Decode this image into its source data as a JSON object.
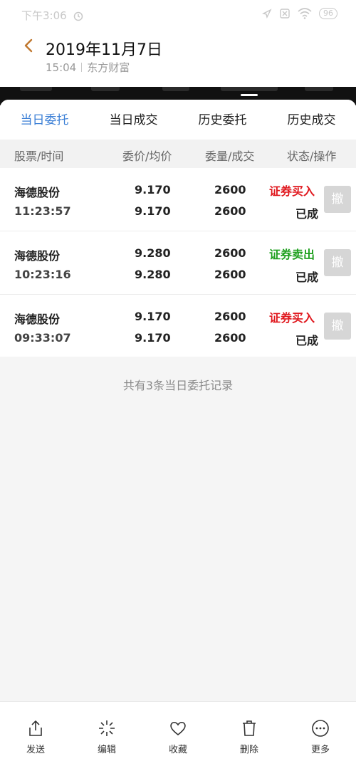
{
  "status_bar": {
    "time": "下午3:06",
    "battery": "96"
  },
  "header": {
    "title": "2019年11月7日",
    "time": "15:04",
    "source": "东方财富"
  },
  "tabs": [
    "当日委托",
    "当日成交",
    "历史委托",
    "历史成交"
  ],
  "active_tab": 0,
  "columns": [
    "股票/时间",
    "委价/均价",
    "委量/成交",
    "状态/操作"
  ],
  "orders": [
    {
      "name": "海德股份",
      "time": "11:23:57",
      "price": "9.170",
      "avg": "9.170",
      "qty": "2600",
      "filled": "2600",
      "type": "证券买入",
      "state": "已成",
      "cancel": "撤",
      "side_color": "#e0181e"
    },
    {
      "name": "海德股份",
      "time": "10:23:16",
      "price": "9.280",
      "avg": "9.280",
      "qty": "2600",
      "filled": "2600",
      "type": "证券卖出",
      "state": "已成",
      "cancel": "撤",
      "side_color": "#1fa01f"
    },
    {
      "name": "海德股份",
      "time": "09:33:07",
      "price": "9.170",
      "avg": "9.170",
      "qty": "2600",
      "filled": "2600",
      "type": "证券买入",
      "state": "已成",
      "cancel": "撤",
      "side_color": "#e0181e"
    }
  ],
  "summary": "共有3条当日委托记录",
  "bottom_bar": [
    {
      "label": "发送",
      "icon": "share-icon"
    },
    {
      "label": "编辑",
      "icon": "edit-sparkle-icon"
    },
    {
      "label": "收藏",
      "icon": "heart-icon"
    },
    {
      "label": "删除",
      "icon": "trash-icon"
    },
    {
      "label": "更多",
      "icon": "more-icon"
    }
  ],
  "colors": {
    "accent": "#3b7fd6",
    "buy": "#e0181e",
    "sell": "#1fa01f",
    "back_arrow": "#c0772e"
  }
}
